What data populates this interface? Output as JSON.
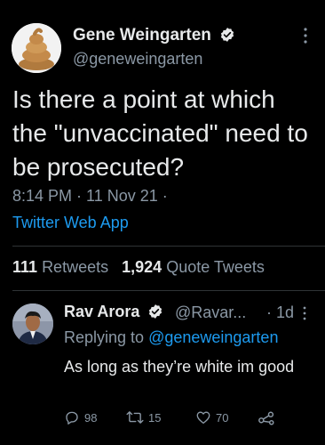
{
  "tweet": {
    "author_name": "Gene Weingarten",
    "author_handle": "@geneweingarten",
    "text": "Is there a point at which the \"unvaccinated\" need to be prosecuted?",
    "timestamp": "8:14 PM · 11 Nov 21 ·",
    "source": "Twitter Web App",
    "retweets_count": "111",
    "retweets_label": "Retweets",
    "quotes_count": "1,924",
    "quotes_label": "Quote Tweets"
  },
  "reply": {
    "author_name": "Rav Arora",
    "author_handle": "@Ravar...",
    "time": "· 1d",
    "replying_prefix": "Replying to",
    "replying_to": "@geneweingarten",
    "text": "As long as they’re white im good",
    "reply_count": "98",
    "retweet_count": "15",
    "like_count": "70"
  },
  "colors": {
    "background": "#000000",
    "text_primary": "#e7e9ea",
    "text_secondary": "#8b98a5",
    "link": "#1d9bf0",
    "verified": "#e7e9ea"
  },
  "icons": [
    "verified-badge-icon",
    "more-options-icon",
    "reply-icon",
    "retweet-icon",
    "like-icon",
    "share-icon"
  ]
}
